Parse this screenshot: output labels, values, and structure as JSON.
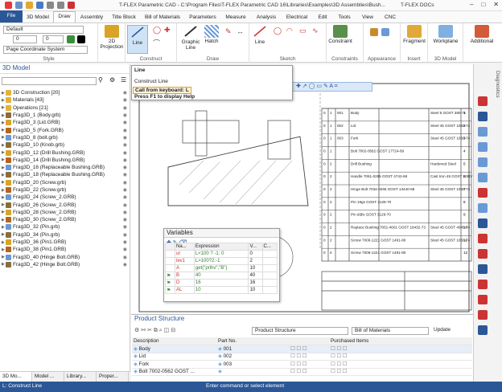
{
  "window": {
    "title": "T-FLEX Parametric CAD - C:\\Program Files\\T-FLEX Parametric CAD 16\\Libraries\\Examples\\3D Assemblies\\Bush...",
    "docs": "T-FLEX DOCs"
  },
  "menu_tabs": [
    "File",
    "3D Model",
    "Draw",
    "Assembly",
    "Title Block",
    "Bill of Materials",
    "Parameters",
    "Measure",
    "Analysis",
    "Electrical",
    "Edit",
    "Tools",
    "View",
    "CNC"
  ],
  "ribbon": {
    "style": {
      "layer": "Default",
      "width": "0",
      "height": "0",
      "coord": "Page Coordinate System",
      "label": "Style"
    },
    "projection": "2D Projection",
    "construct": {
      "line": "Line",
      "label": "Construct"
    },
    "draw": {
      "graphic_line": "Graphic Line",
      "hatch": "Hatch",
      "label": "Draw"
    },
    "sketch": {
      "line": "Line",
      "label": "Sketch"
    },
    "constraints": {
      "constraint": "Constraint",
      "label": "Constraints"
    },
    "appearance": {
      "label": "Appearance"
    },
    "insert": {
      "fragment": "Fragment",
      "label": "Insert"
    },
    "model3d": {
      "workplane": "Workplane",
      "label": "3D Model"
    },
    "additional": "Additional"
  },
  "tooltip": {
    "title": "Line",
    "desc": "Construct Line",
    "keyboard": "Call from keyboard: L",
    "help": "Press F1 to display Help"
  },
  "left_panel": {
    "title": "3D Model",
    "tree": [
      "3D Construction [20]",
      "Materials [43]",
      "Operations [21]",
      "Frag3D_1 (Body.grb)",
      "Frag3D_3 (Lid.GRB)",
      "Frag3D_5 (Fork.GRB)",
      "Frag3D_8 (bolt.grb)",
      "Frag3D_10 (Knob.grb)",
      "Frag3D_12 (Drill Bushing.GRB)",
      "Frag3D_14 (Drill Bushing.GRB)",
      "Frag3D_16 (Replaceable Bushing.GRB)",
      "Frag3D_18 (Replaceable Bushing.GRB)",
      "Frag3D_20 (Screw.grb)",
      "Frag3D_22 (Screw.grb)",
      "Frag3D_24 (Screw_2.GRB)",
      "Frag3D_26 (Screw_2.GRB)",
      "Frag3D_28 (Screw_2.GRB)",
      "Frag3D_30 (Screw_2.GRB)",
      "Frag3D_32 (Pin.grb)",
      "Frag3D_34 (Pin.grb)",
      "Frag3D_36 (Pin1.GRB)",
      "Frag3D_38 (Pin1.GRB)",
      "Frag3D_40 (Hinge Bolt.GRB)",
      "Frag3D_42 (Hinge Bolt.GRB)"
    ],
    "bottom_tabs": [
      "3D Mo...",
      "Model ...",
      "Library...",
      "Proper..."
    ]
  },
  "bom": {
    "rows": [
      [
        "0",
        "1",
        "001",
        "Body",
        "Steel 5 GOST 380-71"
      ],
      [
        "0",
        "1",
        "002",
        "Lid",
        "Steel 45 GOST 1050-74"
      ],
      [
        "0",
        "1",
        "003",
        "Fork",
        "Steel 45 GOST 1050-74"
      ],
      [
        "0",
        "1",
        "",
        "Bolt 7002-0562 GOST 17724-69",
        ""
      ],
      [
        "0",
        "2",
        "",
        "Drill Bushing",
        "Hardened Steel"
      ],
      [
        "0",
        "2",
        "",
        "Handle 7061-0285 GOST 4742-68",
        "Cast Iron 45 GOST 1050-75"
      ],
      [
        "0",
        "2",
        "",
        "Hinge Bolt 7034-0266 GOST 13440-68",
        "Steel 45 GOST 1050-74"
      ],
      [
        "0",
        "2",
        "",
        "Pin 19gs GOST 3128-70",
        ""
      ],
      [
        "0",
        "2",
        "",
        "Pin d@s GOST 3129-70",
        ""
      ],
      [
        "0",
        "2",
        "",
        "Replace Bushing 7051-4601 GOST 18432-73",
        "Steel 45 GOST 4045-74"
      ],
      [
        "0",
        "2",
        "",
        "Screw 7006-1221 GOST 1491-80",
        "Steel 45 GOST 1050-74"
      ],
      [
        "0",
        "4",
        "",
        "Screw 7006-1221 GOST 1491-80",
        ""
      ]
    ],
    "numbers": [
      "1",
      "2",
      "3",
      "4",
      "5",
      "6",
      "7",
      "8",
      "9",
      "10",
      "11",
      "12"
    ]
  },
  "variables": {
    "title": "Variables",
    "headers": [
      "",
      "Na...",
      "Expression",
      "V...",
      "C..."
    ],
    "rows": [
      [
        "",
        "ur",
        "L<100 ? -1: 0",
        "0",
        ""
      ],
      [
        "",
        "lev1",
        "L>100?2:-1",
        "2",
        ""
      ],
      [
        "",
        "A",
        "get(\"prihv\",\"B\")",
        "10",
        ""
      ],
      [
        "flag",
        "B",
        "40",
        "40",
        ""
      ],
      [
        "flag",
        "D",
        "16",
        "16",
        ""
      ],
      [
        "flag",
        "AL",
        "10",
        "10",
        ""
      ]
    ]
  },
  "product": {
    "title": "Product Structure",
    "selector": "Product Structure",
    "bom_selector": "Bill of Materials",
    "update": "Update",
    "headers": [
      "Description",
      "Part No.",
      "",
      "Purchased Items"
    ],
    "rows": [
      [
        "Body",
        "001"
      ],
      [
        "Lid",
        "002"
      ],
      [
        "Fork",
        "003"
      ],
      [
        "Bolt 7002-0562 GOST ...",
        ""
      ]
    ]
  },
  "status": {
    "left": "L: Construct Line",
    "center": "Enter command or select element"
  },
  "diagnostics": "Diagnostics"
}
